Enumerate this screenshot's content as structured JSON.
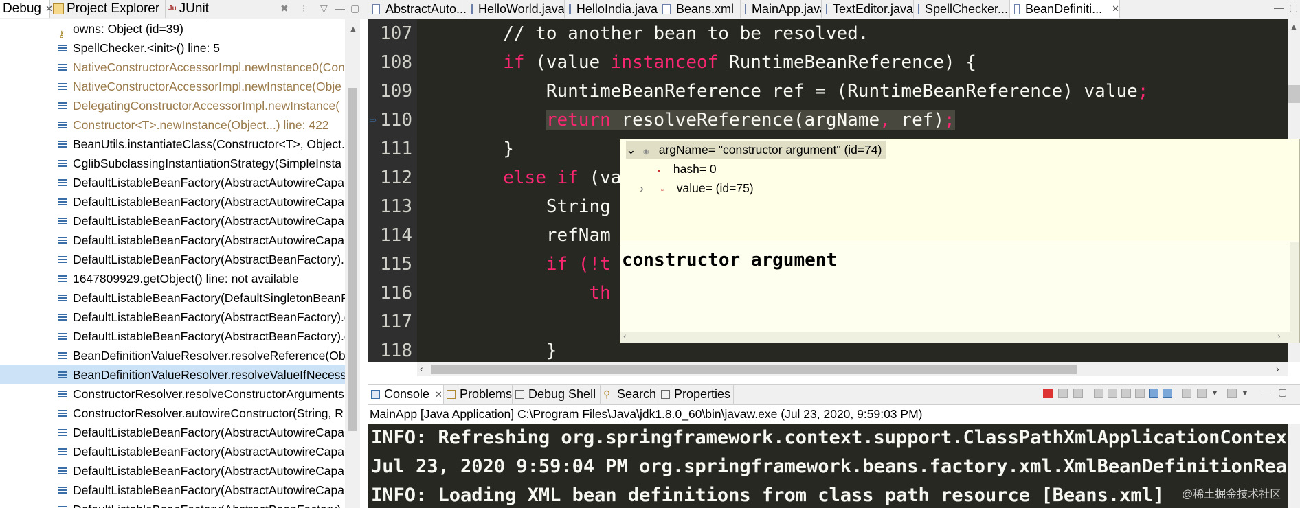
{
  "left_panel": {
    "tabs": [
      {
        "label": "Debug",
        "close": "✕"
      },
      {
        "label": "Project Explorer"
      },
      {
        "label": "JUnit"
      }
    ],
    "frames": [
      {
        "text": "owns: Object  (id=39)",
        "kind": "var"
      },
      {
        "text": "SpellChecker.<init>() line: 5",
        "kind": "normal"
      },
      {
        "text": "NativeConstructorAccessorImpl.newInstance0(Con",
        "kind": "gray"
      },
      {
        "text": "NativeConstructorAccessorImpl.newInstance(Obje",
        "kind": "gray"
      },
      {
        "text": "DelegatingConstructorAccessorImpl.newInstance(",
        "kind": "gray"
      },
      {
        "text": "Constructor<T>.newInstance(Object...) line: 422",
        "kind": "gray"
      },
      {
        "text": "BeanUtils.instantiateClass(Constructor<T>, Object..",
        "kind": "normal"
      },
      {
        "text": "CglibSubclassingInstantiationStrategy(SimpleInsta",
        "kind": "normal"
      },
      {
        "text": "DefaultListableBeanFactory(AbstractAutowireCapal",
        "kind": "normal"
      },
      {
        "text": "DefaultListableBeanFactory(AbstractAutowireCapal",
        "kind": "normal"
      },
      {
        "text": "DefaultListableBeanFactory(AbstractAutowireCapal",
        "kind": "normal"
      },
      {
        "text": "DefaultListableBeanFactory(AbstractAutowireCapal",
        "kind": "normal"
      },
      {
        "text": "DefaultListableBeanFactory(AbstractBeanFactory).la",
        "kind": "normal"
      },
      {
        "text": "1647809929.getObject() line: not available",
        "kind": "normal"
      },
      {
        "text": "DefaultListableBeanFactory(DefaultSingletonBeanR",
        "kind": "normal"
      },
      {
        "text": "DefaultListableBeanFactory(AbstractBeanFactory).d",
        "kind": "normal"
      },
      {
        "text": "DefaultListableBeanFactory(AbstractBeanFactory).g",
        "kind": "normal"
      },
      {
        "text": "BeanDefinitionValueResolver.resolveReference(Obje",
        "kind": "normal"
      },
      {
        "text": "BeanDefinitionValueResolver.resolveValueIfNecessa",
        "kind": "selected"
      },
      {
        "text": "ConstructorResolver.resolveConstructorArguments",
        "kind": "normal"
      },
      {
        "text": "ConstructorResolver.autowireConstructor(String, R",
        "kind": "normal"
      },
      {
        "text": "DefaultListableBeanFactory(AbstractAutowireCapal",
        "kind": "normal"
      },
      {
        "text": "DefaultListableBeanFactory(AbstractAutowireCapal",
        "kind": "normal"
      },
      {
        "text": "DefaultListableBeanFactory(AbstractAutowireCapal",
        "kind": "normal"
      },
      {
        "text": "DefaultListableBeanFactory(AbstractAutowireCapal",
        "kind": "normal"
      },
      {
        "text": "DefaultListableBeanFactory(AbstractBeanFactory).la",
        "kind": "normal"
      }
    ]
  },
  "editor": {
    "tabs": [
      {
        "label": "AbstractAuto...",
        "icon": "java-file-icon"
      },
      {
        "label": "HelloWorld.java",
        "icon": "java-file-icon"
      },
      {
        "label": "HelloIndia.java",
        "icon": "java-file-icon"
      },
      {
        "label": "Beans.xml",
        "icon": "xml-file-icon"
      },
      {
        "label": "MainApp.java",
        "icon": "java-file-icon"
      },
      {
        "label": "TextEditor.java",
        "icon": "java-file-icon"
      },
      {
        "label": "SpellChecker....",
        "icon": "java-file-icon"
      },
      {
        "label": "BeanDefiniti...",
        "icon": "class-file-icon",
        "close": "✕"
      }
    ],
    "line_numbers": [
      "107",
      "108",
      "109",
      "110",
      "111",
      "112",
      "113",
      "114",
      "115",
      "116",
      "117",
      "118"
    ],
    "code": {
      "l107": "        // to another bean to be resolved.",
      "l108_kw1": "if",
      "l108_rest1": " (value ",
      "l108_kw2": "instanceof",
      "l108_rest2": " RuntimeBeanReference) {",
      "l109_a": "            RuntimeBeanReference ref = (RuntimeBeanReference) value",
      "l109_semi": ";",
      "l110_kw": "return",
      "l110_a": " resolveReference(argName",
      "l110_comma": ",",
      "l110_b": " ref)",
      "l110_semi": ";",
      "l111": "        }",
      "l112_kw": "else if",
      "l112_rest": " (va",
      "l113": "            String",
      "l114": "            refNam",
      "l115_kw": "if",
      "l115_rest": " (!t",
      "l116": "th",
      "l117": "",
      "l118": "            }"
    }
  },
  "popup": {
    "rows": [
      {
        "expander": "⌄",
        "text": "argName= \"constructor argument\" (id=74)"
      },
      {
        "text": "hash= 0"
      },
      {
        "expander": "›",
        "text": "value= (id=75)"
      }
    ],
    "detail": "constructor argument"
  },
  "console": {
    "tabs": [
      {
        "label": "Console",
        "close": "✕"
      },
      {
        "label": "Problems"
      },
      {
        "label": "Debug Shell"
      },
      {
        "label": "Search"
      },
      {
        "label": "Properties"
      }
    ],
    "description": "MainApp [Java Application] C:\\Program Files\\Java\\jdk1.8.0_60\\bin\\javaw.exe (Jul 23, 2020, 9:59:03 PM)",
    "lines": [
      "INFO: Refreshing org.springframework.context.support.ClassPathXmlApplicationContex",
      "Jul 23, 2020 9:59:04 PM org.springframework.beans.factory.xml.XmlBeanDefinitionRea",
      "INFO: Loading XML bean definitions from class path resource [Beans.xml]"
    ]
  },
  "watermark": "@稀土掘金技术社区",
  "colors": {
    "editor_bg": "#272822",
    "keyword": "#f92672",
    "selection_bg": "#cce3f7",
    "popup_bg": "#fffff0"
  }
}
